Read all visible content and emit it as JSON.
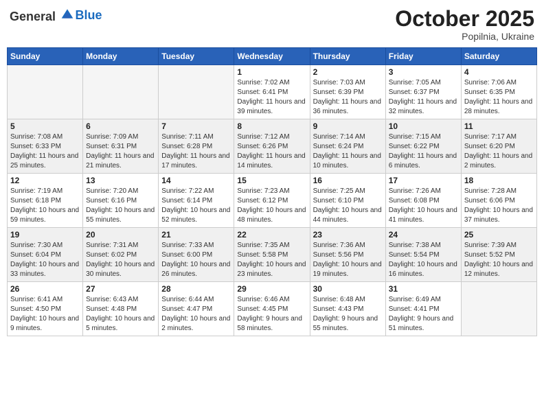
{
  "header": {
    "logo_general": "General",
    "logo_blue": "Blue",
    "month": "October 2025",
    "location": "Popilnia, Ukraine"
  },
  "days_of_week": [
    "Sunday",
    "Monday",
    "Tuesday",
    "Wednesday",
    "Thursday",
    "Friday",
    "Saturday"
  ],
  "weeks": [
    [
      {
        "day": "",
        "sunrise": "",
        "sunset": "",
        "daylight": ""
      },
      {
        "day": "",
        "sunrise": "",
        "sunset": "",
        "daylight": ""
      },
      {
        "day": "",
        "sunrise": "",
        "sunset": "",
        "daylight": ""
      },
      {
        "day": "1",
        "sunrise": "Sunrise: 7:02 AM",
        "sunset": "Sunset: 6:41 PM",
        "daylight": "Daylight: 11 hours and 39 minutes."
      },
      {
        "day": "2",
        "sunrise": "Sunrise: 7:03 AM",
        "sunset": "Sunset: 6:39 PM",
        "daylight": "Daylight: 11 hours and 36 minutes."
      },
      {
        "day": "3",
        "sunrise": "Sunrise: 7:05 AM",
        "sunset": "Sunset: 6:37 PM",
        "daylight": "Daylight: 11 hours and 32 minutes."
      },
      {
        "day": "4",
        "sunrise": "Sunrise: 7:06 AM",
        "sunset": "Sunset: 6:35 PM",
        "daylight": "Daylight: 11 hours and 28 minutes."
      }
    ],
    [
      {
        "day": "5",
        "sunrise": "Sunrise: 7:08 AM",
        "sunset": "Sunset: 6:33 PM",
        "daylight": "Daylight: 11 hours and 25 minutes."
      },
      {
        "day": "6",
        "sunrise": "Sunrise: 7:09 AM",
        "sunset": "Sunset: 6:31 PM",
        "daylight": "Daylight: 11 hours and 21 minutes."
      },
      {
        "day": "7",
        "sunrise": "Sunrise: 7:11 AM",
        "sunset": "Sunset: 6:28 PM",
        "daylight": "Daylight: 11 hours and 17 minutes."
      },
      {
        "day": "8",
        "sunrise": "Sunrise: 7:12 AM",
        "sunset": "Sunset: 6:26 PM",
        "daylight": "Daylight: 11 hours and 14 minutes."
      },
      {
        "day": "9",
        "sunrise": "Sunrise: 7:14 AM",
        "sunset": "Sunset: 6:24 PM",
        "daylight": "Daylight: 11 hours and 10 minutes."
      },
      {
        "day": "10",
        "sunrise": "Sunrise: 7:15 AM",
        "sunset": "Sunset: 6:22 PM",
        "daylight": "Daylight: 11 hours and 6 minutes."
      },
      {
        "day": "11",
        "sunrise": "Sunrise: 7:17 AM",
        "sunset": "Sunset: 6:20 PM",
        "daylight": "Daylight: 11 hours and 2 minutes."
      }
    ],
    [
      {
        "day": "12",
        "sunrise": "Sunrise: 7:19 AM",
        "sunset": "Sunset: 6:18 PM",
        "daylight": "Daylight: 10 hours and 59 minutes."
      },
      {
        "day": "13",
        "sunrise": "Sunrise: 7:20 AM",
        "sunset": "Sunset: 6:16 PM",
        "daylight": "Daylight: 10 hours and 55 minutes."
      },
      {
        "day": "14",
        "sunrise": "Sunrise: 7:22 AM",
        "sunset": "Sunset: 6:14 PM",
        "daylight": "Daylight: 10 hours and 52 minutes."
      },
      {
        "day": "15",
        "sunrise": "Sunrise: 7:23 AM",
        "sunset": "Sunset: 6:12 PM",
        "daylight": "Daylight: 10 hours and 48 minutes."
      },
      {
        "day": "16",
        "sunrise": "Sunrise: 7:25 AM",
        "sunset": "Sunset: 6:10 PM",
        "daylight": "Daylight: 10 hours and 44 minutes."
      },
      {
        "day": "17",
        "sunrise": "Sunrise: 7:26 AM",
        "sunset": "Sunset: 6:08 PM",
        "daylight": "Daylight: 10 hours and 41 minutes."
      },
      {
        "day": "18",
        "sunrise": "Sunrise: 7:28 AM",
        "sunset": "Sunset: 6:06 PM",
        "daylight": "Daylight: 10 hours and 37 minutes."
      }
    ],
    [
      {
        "day": "19",
        "sunrise": "Sunrise: 7:30 AM",
        "sunset": "Sunset: 6:04 PM",
        "daylight": "Daylight: 10 hours and 33 minutes."
      },
      {
        "day": "20",
        "sunrise": "Sunrise: 7:31 AM",
        "sunset": "Sunset: 6:02 PM",
        "daylight": "Daylight: 10 hours and 30 minutes."
      },
      {
        "day": "21",
        "sunrise": "Sunrise: 7:33 AM",
        "sunset": "Sunset: 6:00 PM",
        "daylight": "Daylight: 10 hours and 26 minutes."
      },
      {
        "day": "22",
        "sunrise": "Sunrise: 7:35 AM",
        "sunset": "Sunset: 5:58 PM",
        "daylight": "Daylight: 10 hours and 23 minutes."
      },
      {
        "day": "23",
        "sunrise": "Sunrise: 7:36 AM",
        "sunset": "Sunset: 5:56 PM",
        "daylight": "Daylight: 10 hours and 19 minutes."
      },
      {
        "day": "24",
        "sunrise": "Sunrise: 7:38 AM",
        "sunset": "Sunset: 5:54 PM",
        "daylight": "Daylight: 10 hours and 16 minutes."
      },
      {
        "day": "25",
        "sunrise": "Sunrise: 7:39 AM",
        "sunset": "Sunset: 5:52 PM",
        "daylight": "Daylight: 10 hours and 12 minutes."
      }
    ],
    [
      {
        "day": "26",
        "sunrise": "Sunrise: 6:41 AM",
        "sunset": "Sunset: 4:50 PM",
        "daylight": "Daylight: 10 hours and 9 minutes."
      },
      {
        "day": "27",
        "sunrise": "Sunrise: 6:43 AM",
        "sunset": "Sunset: 4:48 PM",
        "daylight": "Daylight: 10 hours and 5 minutes."
      },
      {
        "day": "28",
        "sunrise": "Sunrise: 6:44 AM",
        "sunset": "Sunset: 4:47 PM",
        "daylight": "Daylight: 10 hours and 2 minutes."
      },
      {
        "day": "29",
        "sunrise": "Sunrise: 6:46 AM",
        "sunset": "Sunset: 4:45 PM",
        "daylight": "Daylight: 9 hours and 58 minutes."
      },
      {
        "day": "30",
        "sunrise": "Sunrise: 6:48 AM",
        "sunset": "Sunset: 4:43 PM",
        "daylight": "Daylight: 9 hours and 55 minutes."
      },
      {
        "day": "31",
        "sunrise": "Sunrise: 6:49 AM",
        "sunset": "Sunset: 4:41 PM",
        "daylight": "Daylight: 9 hours and 51 minutes."
      },
      {
        "day": "",
        "sunrise": "",
        "sunset": "",
        "daylight": ""
      }
    ]
  ]
}
